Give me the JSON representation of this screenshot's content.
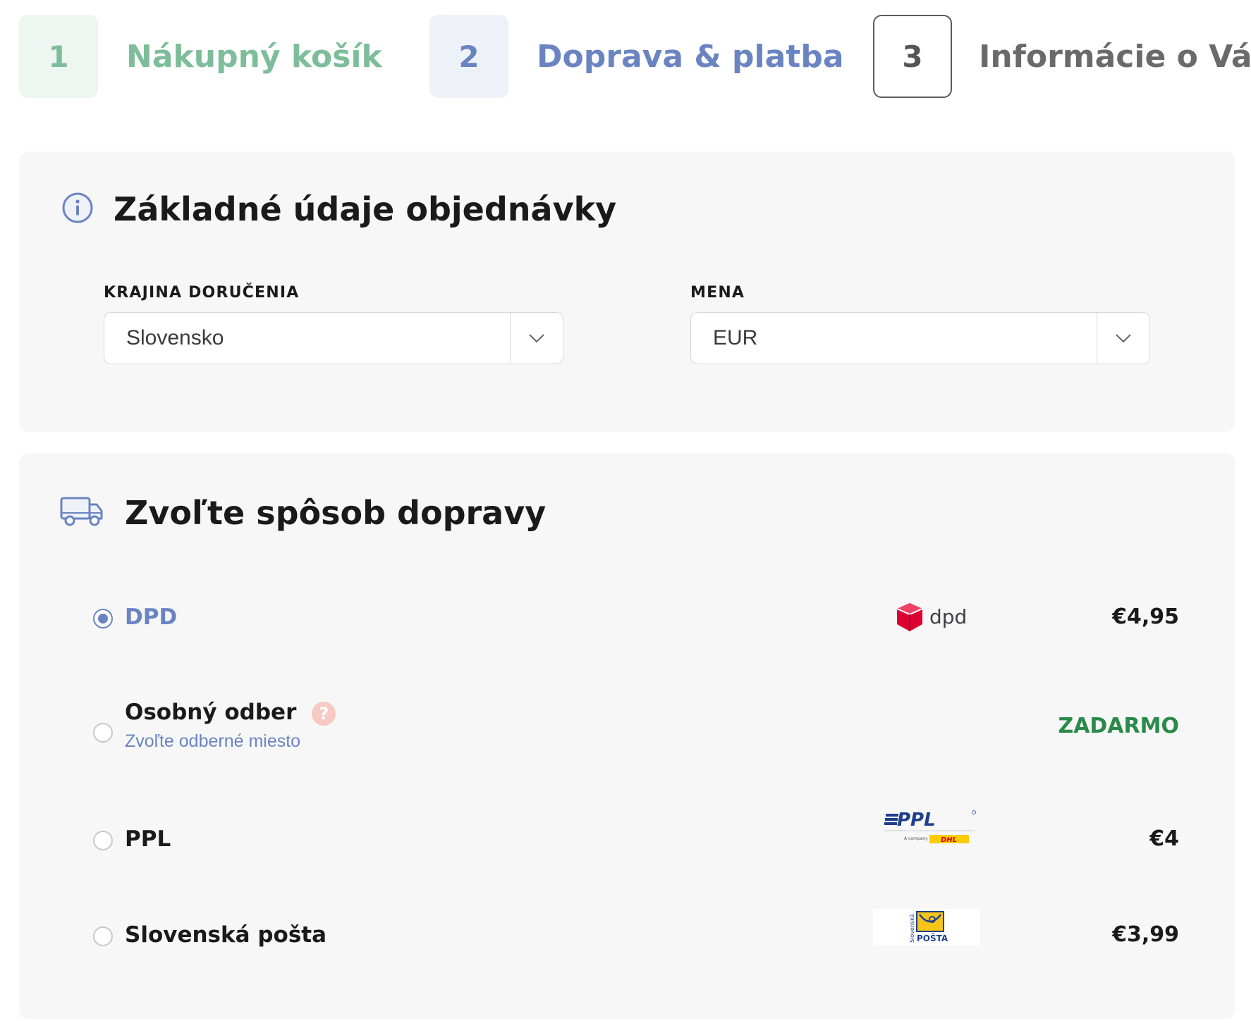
{
  "steps": [
    {
      "number": "1",
      "label": "Nákupný košík",
      "state": "done"
    },
    {
      "number": "2",
      "label": "Doprava & platba",
      "state": "current"
    },
    {
      "number": "3",
      "label": "Informácie o Vás",
      "state": "upcoming"
    }
  ],
  "basic": {
    "title": "Základné údaje objednávky",
    "icon": "info-icon",
    "country": {
      "label": "KRAJINA DORUČENIA",
      "value": "Slovensko"
    },
    "currency": {
      "label": "MENA",
      "value": "EUR"
    }
  },
  "shipping": {
    "title": "Zvoľte spôsob dopravy",
    "icon": "truck-icon",
    "options": [
      {
        "name": "DPD",
        "price": "€4,95",
        "selected": true,
        "logo": "dpd-logo",
        "logo_text": "dpd"
      },
      {
        "name": "Osobný odber",
        "subtitle": "Zvoľte odberné miesto",
        "help": "?",
        "price": "ZADARMO",
        "selected": false
      },
      {
        "name": "PPL",
        "price": "€4",
        "selected": false,
        "logo": "ppl-logo",
        "logo_text": "PPL",
        "logo_small_text": "A company of",
        "logo_dhl_text": "DHL"
      },
      {
        "name": "Slovenská pošta",
        "price": "€3,99",
        "selected": false,
        "logo": "slovenska-posta-logo",
        "logo_text": "POŠTA",
        "logo_vertical_text": "Slovenská"
      }
    ]
  },
  "colors": {
    "step_done": "#7dbd99",
    "step_current": "#6a84c2",
    "accent": "#6a84c2",
    "free_price": "#2a8a4a",
    "dpd_red": "#dc0032",
    "ppl_blue": "#1e3f8f",
    "dhl_yellow": "#ffcc00",
    "posta_yellow": "#f5c518"
  }
}
